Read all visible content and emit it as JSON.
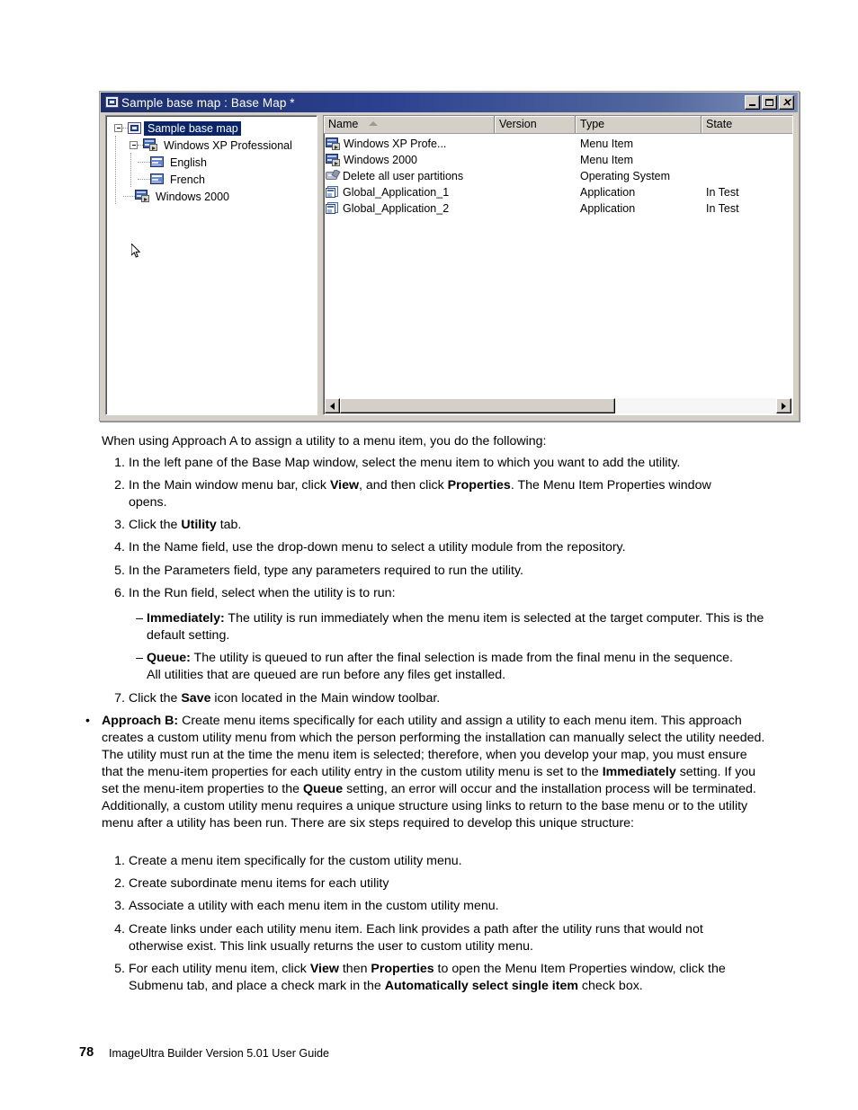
{
  "screenshot": {
    "window": {
      "title": "Sample base map : Base Map *",
      "title_icon": "base-map-icon",
      "buttons": {
        "minimize": "_",
        "maximize": "□",
        "close": "✕"
      },
      "tree": {
        "nodes": [
          {
            "label": "Sample base map",
            "icon": "base-map-icon",
            "level": 0,
            "selected": true,
            "expander": "collapse"
          },
          {
            "label": "Windows XP Professional",
            "icon": "menu-item-icon",
            "level": 1,
            "selected": false,
            "expander": "collapse"
          },
          {
            "label": "English",
            "icon": "language-icon",
            "level": 2,
            "selected": false,
            "expander": "none"
          },
          {
            "label": "French",
            "icon": "language-icon",
            "level": 2,
            "selected": false,
            "expander": "none"
          },
          {
            "label": "Windows 2000",
            "icon": "menu-item-icon",
            "level": 1,
            "selected": false,
            "expander": "none"
          }
        ]
      },
      "list": {
        "columns": [
          {
            "label": "Name",
            "sort": "ascending"
          },
          {
            "label": "Version",
            "sort": "none"
          },
          {
            "label": "Type",
            "sort": "none"
          },
          {
            "label": "State",
            "sort": "none"
          }
        ],
        "rows": [
          {
            "icon": "menu-item-icon",
            "name": "Windows XP Profe...",
            "version": "",
            "type": "Menu Item",
            "state": ""
          },
          {
            "icon": "menu-item-icon",
            "name": "Windows 2000",
            "version": "",
            "type": "Menu Item",
            "state": ""
          },
          {
            "icon": "operating-system-icon",
            "name": "Delete all user partitions",
            "version": "",
            "type": "Operating System",
            "state": ""
          },
          {
            "icon": "application-icon",
            "name": "Global_Application_1",
            "version": "",
            "type": "Application",
            "state": "In Test"
          },
          {
            "icon": "application-icon",
            "name": "Global_Application_2",
            "version": "",
            "type": "Application",
            "state": "In Test"
          }
        ]
      }
    }
  },
  "document": {
    "intro": "When using Approach A to assign a utility to a menu item, you do the following:",
    "steps_a": [
      {
        "num": "1.",
        "html": "In the left pane of the Base Map window, select the menu item to which you want to add the utility."
      },
      {
        "num": "2.",
        "html": "In the Main window menu bar, click <b>View</b>, and then click <b>Properties</b>.  The Menu Item Properties window opens."
      },
      {
        "num": "3.",
        "html": "Click the <b>Utility</b> tab."
      },
      {
        "num": "4.",
        "html": "In the Name field, use the drop-down menu to select a utility module from the repository."
      },
      {
        "num": "5.",
        "html": "In the Parameters field, type any parameters required to run the utility."
      },
      {
        "num": "6.",
        "html": "In the Run field, select when the utility is to run:"
      }
    ],
    "run_options": [
      {
        "marker": "–",
        "html": "<b>Immediately:</b> The utility is run immediately when the menu item is selected at the target computer.  This is the default setting."
      },
      {
        "marker": "–",
        "html": "<b>Queue:</b> The utility is queued to run after the final selection is made from the final menu in the sequence.  All utilities that are queued are run before any files get installed."
      }
    ],
    "step_seven": {
      "num": "7.",
      "html": "Click the <b>Save</b> icon located in the Main window toolbar."
    },
    "approach_b": {
      "marker": "•",
      "html": "<b>Approach B:</b> Create menu items specifically for each utility and assign a utility to each menu item.  This approach creates a custom utility menu from which the person performing the installation can manually select the utility needed.  The utility must run at the time the menu item is selected; therefore, when you develop your map, you must ensure that the menu-item properties for each utility entry in the custom utility menu is set to the <b>Immediately</b> setting.  If you set the menu-item properties to the <b>Queue</b> setting, an error will occur and the installation process will be terminated.  Additionally, a custom utility menu requires a unique structure using links to return to the base menu or to the utility menu after a utility has been run.  There are six steps required to develop this unique structure:"
    },
    "steps_b": [
      {
        "num": "1.",
        "html": "Create a menu item specifically for the custom utility menu."
      },
      {
        "num": "2.",
        "html": "Create subordinate menu items for each utility"
      },
      {
        "num": "3.",
        "html": "Associate a utility with each menu item in the custom utility menu."
      },
      {
        "num": "4.",
        "html": "Create links under each utility menu item. Each link provides a path after the utility runs that would not otherwise exist.  This link usually returns the user to custom utility menu."
      },
      {
        "num": "5.",
        "html": "For each utility menu item, click <b>View</b> then <b>Properties</b> to open the Menu Item Properties window, click the Submenu tab, and place a check mark in the <b>Automatically select single item</b> check box."
      }
    ],
    "footer": {
      "page_number": "78",
      "text": "ImageUltra Builder Version 5.01 User Guide"
    }
  }
}
